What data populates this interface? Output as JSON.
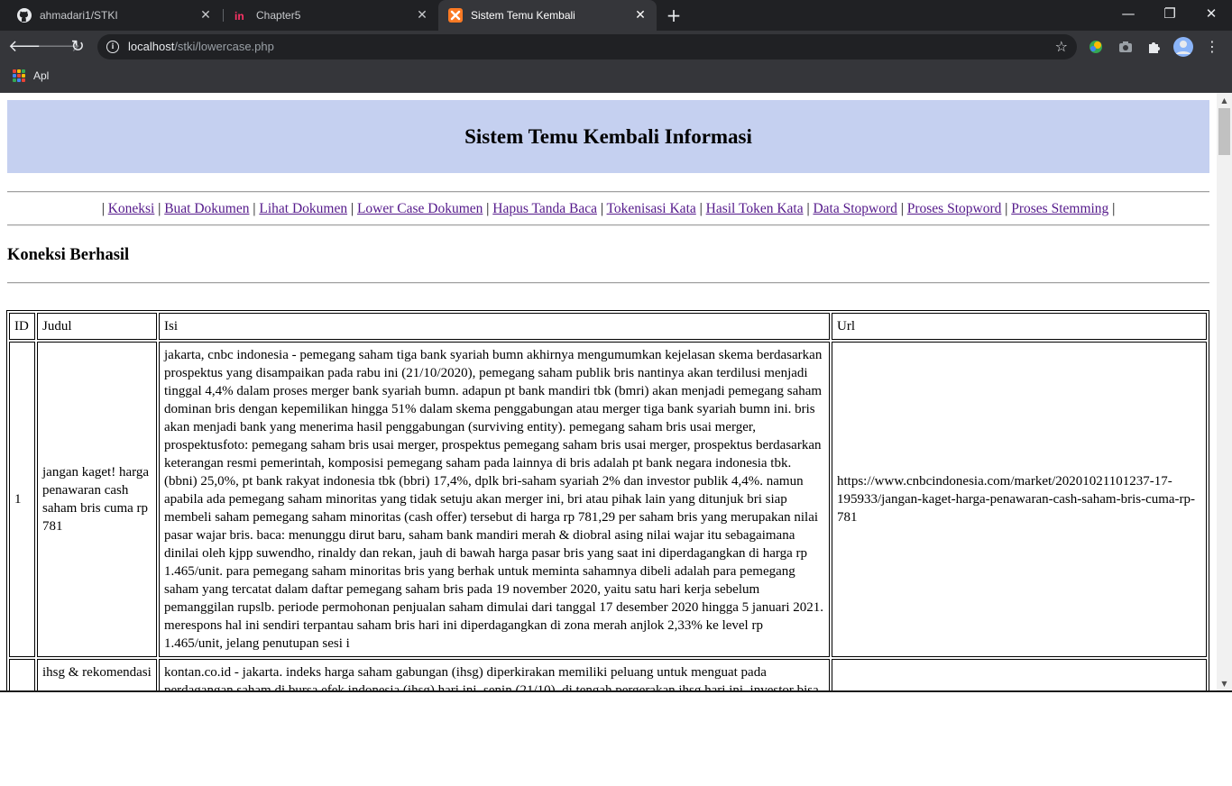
{
  "browser": {
    "tabs": [
      {
        "title": "ahmadari1/STKI",
        "favicon": "github-icon",
        "active": false
      },
      {
        "title": "Chapter5",
        "favicon": "invision-icon",
        "active": false
      },
      {
        "title": "Sistem Temu Kembali",
        "favicon": "xampp-icon",
        "active": true
      }
    ],
    "url_host": "localhost",
    "url_path": "/stki/lowercase.php",
    "bookmark_apps_label": "Apl"
  },
  "page": {
    "title": "Sistem Temu Kembali Informasi",
    "menu": [
      "Koneksi",
      "Buat Dokumen",
      "Lihat Dokumen",
      "Lower Case Dokumen",
      "Hapus Tanda Baca",
      "Tokenisasi Kata",
      "Hasil Token Kata",
      "Data Stopword",
      "Proses Stopword",
      "Proses Stemming"
    ],
    "status": "Koneksi Berhasil",
    "table": {
      "headers": [
        "ID",
        "Judul",
        "Isi",
        "Url"
      ],
      "rows": [
        {
          "id": "1",
          "judul": "jangan kaget! harga penawaran cash saham bris cuma rp 781",
          "isi": "jakarta, cnbc indonesia - pemegang saham tiga bank syariah bumn akhirnya mengumumkan kejelasan skema berdasarkan prospektus yang disampaikan pada rabu ini (21/10/2020), pemegang saham publik bris nantinya akan terdilusi menjadi tinggal 4,4% dalam proses merger bank syariah bumn. adapun pt bank mandiri tbk (bmri) akan menjadi pemegang saham dominan bris dengan kepemilikan hingga 51% dalam skema penggabungan atau merger tiga bank syariah bumn ini. bris akan menjadi bank yang menerima hasil penggabungan (surviving entity). pemegang saham bris usai merger, prospektusfoto: pemegang saham bris usai merger, prospektus pemegang saham bris usai merger, prospektus berdasarkan keterangan resmi pemerintah, komposisi pemegang saham pada lainnya di bris adalah pt bank negara indonesia tbk. (bbni) 25,0%, pt bank rakyat indonesia tbk (bbri) 17,4%, dplk bri-saham syariah 2% dan investor publik 4,4%. namun apabila ada pemegang saham minoritas yang tidak setuju akan merger ini, bri atau pihak lain yang ditunjuk bri siap membeli saham pemegang saham minoritas (cash offer) tersebut di harga rp 781,29 per saham bris yang merupakan nilai pasar wajar bris. baca: menunggu dirut baru, saham bank mandiri merah & diobral asing nilai wajar itu sebagaimana dinilai oleh kjpp suwendho, rinaldy dan rekan, jauh di bawah harga pasar bris yang saat ini diperdagangkan di harga rp 1.465/unit. para pemegang saham minoritas bris yang berhak untuk meminta sahamnya dibeli adalah para pemegang saham yang tercatat dalam daftar pemegang saham bris pada 19 november 2020, yaitu satu hari kerja sebelum pemanggilan rupslb. periode permohonan penjualan saham dimulai dari tanggal 17 desember 2020 hingga 5 januari 2021. merespons hal ini sendiri terpantau saham bris hari ini diperdagangkan di zona merah anjlok 2,33% ke level rp 1.465/unit, jelang penutupan sesi i",
          "url": "https://www.cnbcindonesia.com/market/20201021101237-17-195933/jangan-kaget-harga-penawaran-cash-saham-bris-cuma-rp-781"
        },
        {
          "id": "",
          "judul": "ihsg & rekomendasi",
          "isi": "kontan.co.id - jakarta. indeks harga saham gabungan (ihsg) diperkirakan memiliki peluang untuk menguat pada perdagangan saham di bursa efek indonesia (ihsg) hari ini, senin (21/10). di tengah pergerakan ihsg hari ini, investor bisa",
          "url": ""
        }
      ]
    }
  }
}
